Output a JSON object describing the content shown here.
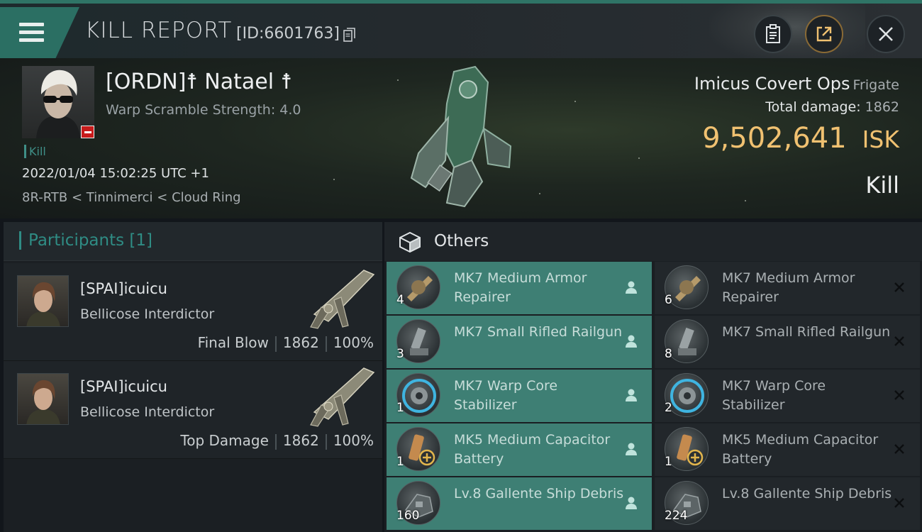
{
  "header": {
    "title": "KILL REPORT",
    "report_id": "[ID:6601763]"
  },
  "victim": {
    "name": "[ORDN]☨ Natael ☨",
    "scramble": "Warp Scramble Strength: 4.0",
    "tag": "Kill",
    "datetime": "2022/01/04 15:02:25 UTC +1",
    "location": "8R-RTB < Tinnimerci < Cloud Ring"
  },
  "ship": {
    "name": "Imicus Covert Ops",
    "class": "Frigate",
    "damage_label": "Total damage:",
    "damage_value": "1862",
    "isk_value": "9,502,641",
    "isk_unit": "ISK",
    "kill_type": "Kill"
  },
  "participants": {
    "heading": "Participants [1]",
    "rows": [
      {
        "name": "[SPAI]icuicu",
        "ship": "Bellicose Interdictor",
        "role": "Final Blow",
        "damage": "1862",
        "percent": "100%"
      },
      {
        "name": "[SPAI]icuicu",
        "ship": "Bellicose Interdictor",
        "role": "Top Damage",
        "damage": "1862",
        "percent": "100%"
      }
    ]
  },
  "others": {
    "heading": "Others",
    "dropped": [
      {
        "name": "MK7 Medium Armor Repairer",
        "qty": "4",
        "icon": "armor-repairer-icon"
      },
      {
        "name": "MK7 Small Rifled Railgun",
        "qty": "3",
        "icon": "railgun-icon"
      },
      {
        "name": "MK7 Warp Core Stabilizer",
        "qty": "1",
        "icon": "warp-core-stabilizer-icon"
      },
      {
        "name": "MK5 Medium Capacitor Battery",
        "qty": "1",
        "icon": "capacitor-battery-icon"
      },
      {
        "name": "Lv.8 Gallente Ship Debris",
        "qty": "160",
        "icon": "ship-debris-icon"
      }
    ],
    "destroyed": [
      {
        "name": "MK7 Medium Armor Repairer",
        "qty": "6",
        "icon": "armor-repairer-icon"
      },
      {
        "name": "MK7 Small Rifled Railgun",
        "qty": "8",
        "icon": "railgun-icon"
      },
      {
        "name": "MK7 Warp Core Stabilizer",
        "qty": "2",
        "icon": "warp-core-stabilizer-icon"
      },
      {
        "name": "MK5 Medium Capacitor Battery",
        "qty": "1",
        "icon": "capacitor-battery-icon"
      },
      {
        "name": "Lv.8 Gallente Ship Debris",
        "qty": "224",
        "icon": "ship-debris-icon"
      }
    ]
  },
  "colors": {
    "accent": "#2f8c84",
    "highlight_row": "#3e7f74",
    "isk": "#f0c171",
    "remove_badge": "#c71b1b"
  }
}
